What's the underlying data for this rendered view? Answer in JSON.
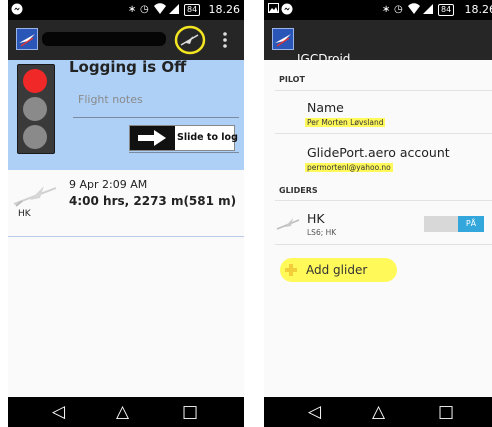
{
  "colors": {
    "status_bar": "#000000",
    "app_bar": "#262626",
    "log_panel": "#aed0f7",
    "lamp_red": "#f02828",
    "lamp_off": "#8a8a8a",
    "highlight": "#fff95a",
    "toggle_on": "#33a7dc"
  },
  "left_screen": {
    "status_bar": {
      "icons": [
        "messenger-icon",
        "bluetooth-icon",
        "alarm-icon",
        "wifi-icon",
        "signal-icon"
      ],
      "battery": "84",
      "time": "18.26"
    },
    "app_bar": {
      "icons": [
        "app-icon",
        "glider-icon",
        "overflow-menu-icon"
      ]
    },
    "logging": {
      "status": "Logging is Off",
      "notes_placeholder": "Flight notes",
      "slide_label": "Slide to log",
      "traffic_light_active": "red"
    },
    "flights": [
      {
        "time": "9 Apr 2:09 AM",
        "stats": "4:00 hrs,   2273 m(581 m)",
        "glider": "HK"
      }
    ]
  },
  "right_screen": {
    "status_bar": {
      "icons": [
        "gallery-icon",
        "messenger-icon",
        "bluetooth-icon",
        "alarm-icon",
        "wifi-icon",
        "signal-icon"
      ],
      "battery": "84",
      "time": "18.26"
    },
    "app_bar": {
      "title": "IGCDroid"
    },
    "pilot": {
      "header": "PILOT",
      "name_label": "Name",
      "name_value": "Per Morten Løvsland",
      "account_label": "GlidePort.aero account",
      "account_value": "permortenl@yahoo.no"
    },
    "gliders": {
      "header": "GLIDERS",
      "items": [
        {
          "name": "HK",
          "detail": "LS6; HK",
          "toggle": "PÅ"
        }
      ],
      "add_label": "Add glider"
    }
  },
  "navigation": {
    "icons": [
      "back-icon",
      "home-icon",
      "recents-icon"
    ]
  }
}
